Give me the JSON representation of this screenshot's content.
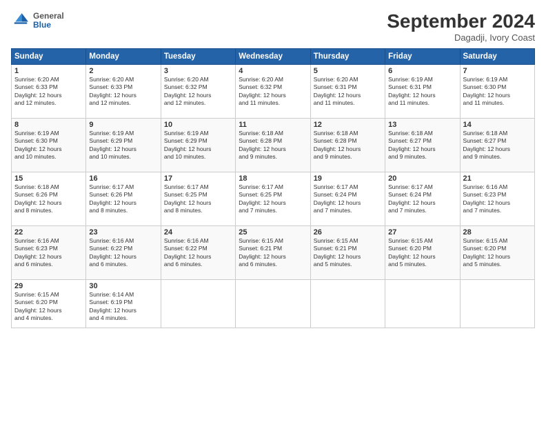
{
  "header": {
    "title": "September 2024",
    "location": "Dagadji, Ivory Coast",
    "logo_general": "General",
    "logo_blue": "Blue"
  },
  "columns": [
    "Sunday",
    "Monday",
    "Tuesday",
    "Wednesday",
    "Thursday",
    "Friday",
    "Saturday"
  ],
  "weeks": [
    [
      {
        "day": "1",
        "rise": "6:20 AM",
        "set": "6:33 PM",
        "daylight": "12 hours and 12 minutes."
      },
      {
        "day": "2",
        "rise": "6:20 AM",
        "set": "6:33 PM",
        "daylight": "12 hours and 12 minutes."
      },
      {
        "day": "3",
        "rise": "6:20 AM",
        "set": "6:32 PM",
        "daylight": "12 hours and 12 minutes."
      },
      {
        "day": "4",
        "rise": "6:20 AM",
        "set": "6:32 PM",
        "daylight": "12 hours and 11 minutes."
      },
      {
        "day": "5",
        "rise": "6:20 AM",
        "set": "6:31 PM",
        "daylight": "12 hours and 11 minutes."
      },
      {
        "day": "6",
        "rise": "6:19 AM",
        "set": "6:31 PM",
        "daylight": "12 hours and 11 minutes."
      },
      {
        "day": "7",
        "rise": "6:19 AM",
        "set": "6:30 PM",
        "daylight": "12 hours and 11 minutes."
      }
    ],
    [
      {
        "day": "8",
        "rise": "6:19 AM",
        "set": "6:30 PM",
        "daylight": "12 hours and 10 minutes."
      },
      {
        "day": "9",
        "rise": "6:19 AM",
        "set": "6:29 PM",
        "daylight": "12 hours and 10 minutes."
      },
      {
        "day": "10",
        "rise": "6:19 AM",
        "set": "6:29 PM",
        "daylight": "12 hours and 10 minutes."
      },
      {
        "day": "11",
        "rise": "6:18 AM",
        "set": "6:28 PM",
        "daylight": "12 hours and 9 minutes."
      },
      {
        "day": "12",
        "rise": "6:18 AM",
        "set": "6:28 PM",
        "daylight": "12 hours and 9 minutes."
      },
      {
        "day": "13",
        "rise": "6:18 AM",
        "set": "6:27 PM",
        "daylight": "12 hours and 9 minutes."
      },
      {
        "day": "14",
        "rise": "6:18 AM",
        "set": "6:27 PM",
        "daylight": "12 hours and 9 minutes."
      }
    ],
    [
      {
        "day": "15",
        "rise": "6:18 AM",
        "set": "6:26 PM",
        "daylight": "12 hours and 8 minutes."
      },
      {
        "day": "16",
        "rise": "6:17 AM",
        "set": "6:26 PM",
        "daylight": "12 hours and 8 minutes."
      },
      {
        "day": "17",
        "rise": "6:17 AM",
        "set": "6:25 PM",
        "daylight": "12 hours and 8 minutes."
      },
      {
        "day": "18",
        "rise": "6:17 AM",
        "set": "6:25 PM",
        "daylight": "12 hours and 7 minutes."
      },
      {
        "day": "19",
        "rise": "6:17 AM",
        "set": "6:24 PM",
        "daylight": "12 hours and 7 minutes."
      },
      {
        "day": "20",
        "rise": "6:17 AM",
        "set": "6:24 PM",
        "daylight": "12 hours and 7 minutes."
      },
      {
        "day": "21",
        "rise": "6:16 AM",
        "set": "6:23 PM",
        "daylight": "12 hours and 7 minutes."
      }
    ],
    [
      {
        "day": "22",
        "rise": "6:16 AM",
        "set": "6:23 PM",
        "daylight": "12 hours and 6 minutes."
      },
      {
        "day": "23",
        "rise": "6:16 AM",
        "set": "6:22 PM",
        "daylight": "12 hours and 6 minutes."
      },
      {
        "day": "24",
        "rise": "6:16 AM",
        "set": "6:22 PM",
        "daylight": "12 hours and 6 minutes."
      },
      {
        "day": "25",
        "rise": "6:15 AM",
        "set": "6:21 PM",
        "daylight": "12 hours and 6 minutes."
      },
      {
        "day": "26",
        "rise": "6:15 AM",
        "set": "6:21 PM",
        "daylight": "12 hours and 5 minutes."
      },
      {
        "day": "27",
        "rise": "6:15 AM",
        "set": "6:20 PM",
        "daylight": "12 hours and 5 minutes."
      },
      {
        "day": "28",
        "rise": "6:15 AM",
        "set": "6:20 PM",
        "daylight": "12 hours and 5 minutes."
      }
    ],
    [
      {
        "day": "29",
        "rise": "6:15 AM",
        "set": "6:20 PM",
        "daylight": "12 hours and 4 minutes."
      },
      {
        "day": "30",
        "rise": "6:14 AM",
        "set": "6:19 PM",
        "daylight": "12 hours and 4 minutes."
      },
      null,
      null,
      null,
      null,
      null
    ]
  ]
}
